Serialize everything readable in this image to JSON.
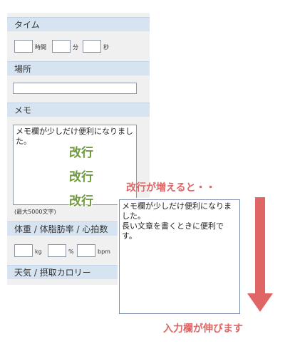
{
  "sections": {
    "time_label": "タイム",
    "place_label": "場所",
    "memo_label": "メモ",
    "body_label": "体重 / 体脂肪率 / 心拍数",
    "weather_label": "天気 / 摂取カロリー"
  },
  "time": {
    "hours_unit": "時間",
    "minutes_unit": "分",
    "seconds_unit": "秒"
  },
  "body": {
    "weight_unit": "kg",
    "fat_unit": "%",
    "hr_unit": "bpm"
  },
  "memo": {
    "text": "メモ欄が少しだけ便利になりました。",
    "max_note": "(最大5000文字)"
  },
  "annotations": {
    "newline_1": "改行",
    "newline_2": "改行",
    "newline_3": "改行",
    "grows_caption": "改行が増えると・・",
    "stretches_caption": "入力欄が伸びます"
  },
  "expanded_memo": {
    "text": "メモ欄が少しだけ便利になりました。\n長い文章を書くときに便利です。"
  },
  "colors": {
    "accent": "#e06666",
    "section_header": "#d6e4f2",
    "newline_label": "#6f9a3c"
  }
}
